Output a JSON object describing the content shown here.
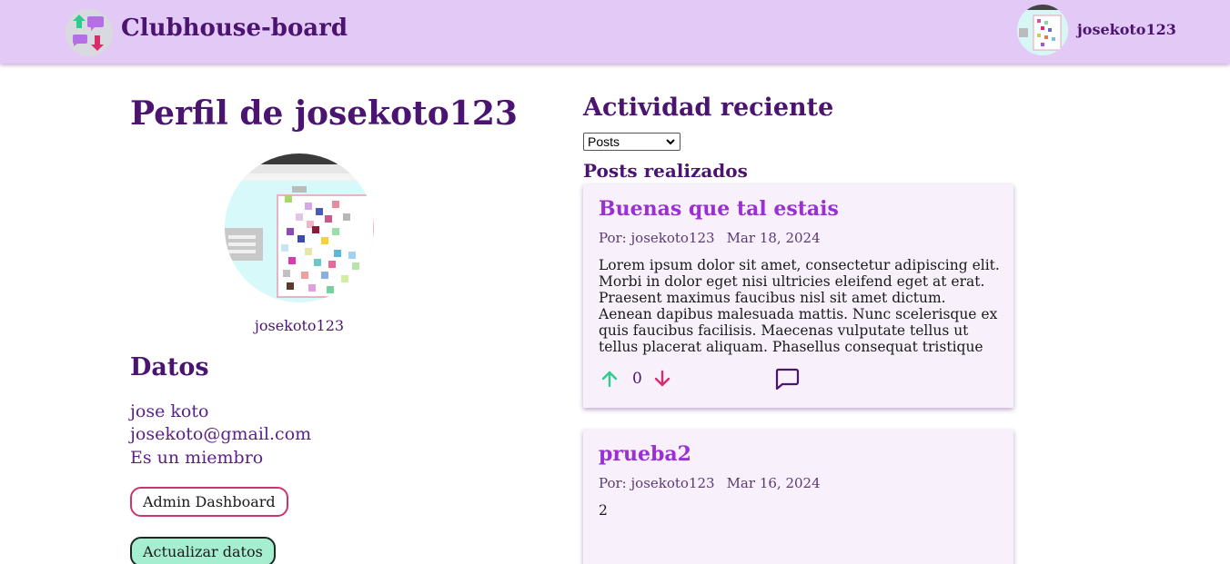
{
  "header": {
    "app_name": "Clubhouse-board",
    "logo_icon": "chat-arrows-logo-icon",
    "username": "josekoto123"
  },
  "profile": {
    "title": "Perfil de josekoto123",
    "avatar_caption": "josekoto123",
    "datos_title": "Datos",
    "full_name": "jose koto",
    "email": "josekoto@gmail.com",
    "membership": "Es un miembro",
    "admin_button": "Admin Dashboard",
    "update_button": "Actualizar datos"
  },
  "activity": {
    "title": "Actividad reciente",
    "filter_selected": "Posts",
    "posts_heading": "Posts realizados",
    "posts": [
      {
        "title": "Buenas que tal estais",
        "author": "Por: josekoto123",
        "date": "Mar 18, 2024",
        "body": "Lorem ipsum dolor sit amet, consectetur adipiscing elit. Morbi in dolor eget nisi ultricies eleifend eget at erat. Praesent maximus faucibus nisl sit amet dictum. Aenean dapibus malesuada mattis. Nunc scelerisque ex quis faucibus facilisis. Maecenas vulputate tellus ut tellus placerat aliquam. Phasellus consequat tristique",
        "votes": "0"
      },
      {
        "title": "prueba2",
        "author": "Por: josekoto123",
        "date": "Mar 16, 2024",
        "body": "2"
      }
    ]
  },
  "colors": {
    "header_bg": "#e3c9f5",
    "primary_text": "#4a1470",
    "post_title": "#9a2fd3",
    "upvote": "#2ecc8f",
    "downvote": "#d92b6e",
    "admin_border": "#c9356f",
    "update_bg": "#a5efd0"
  }
}
